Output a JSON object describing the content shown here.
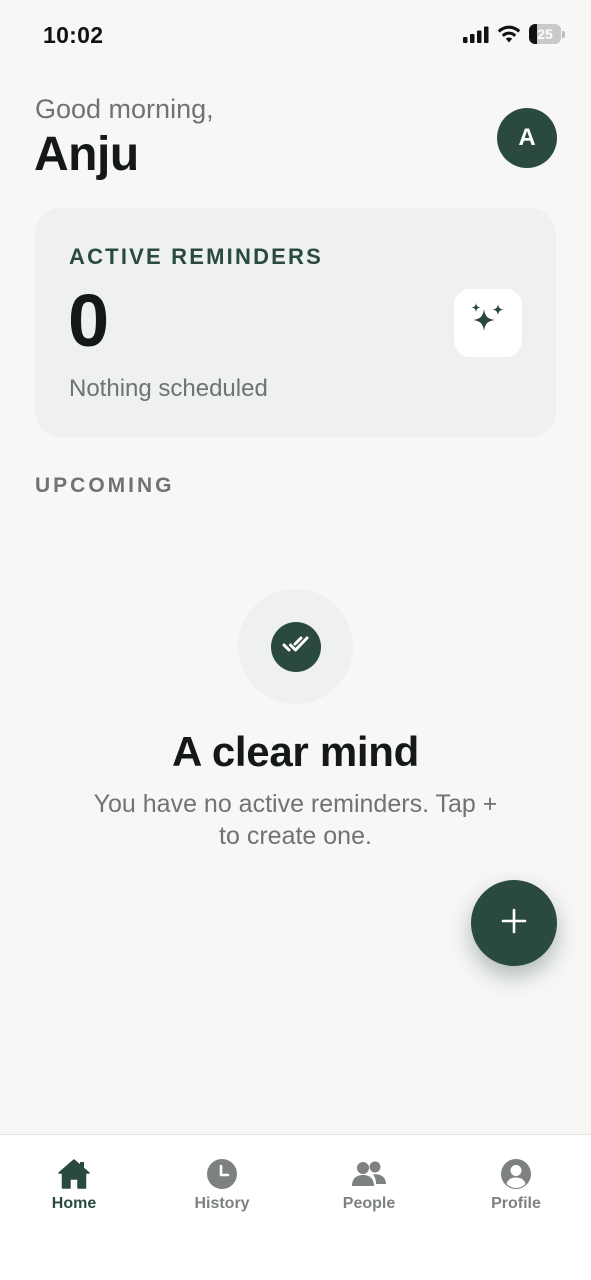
{
  "status_bar": {
    "time": "10:02",
    "battery_level": "25",
    "icons": [
      "signal-icon",
      "wifi-icon",
      "battery-icon"
    ]
  },
  "header": {
    "greeting": "Good morning,",
    "user_name": "Anju",
    "avatar_initial": "A"
  },
  "reminders_card": {
    "title": "ACTIVE REMINDERS",
    "count": "0",
    "subtitle": "Nothing scheduled",
    "icon": "sparkles-icon"
  },
  "upcoming": {
    "label": "UPCOMING",
    "empty_icon": "double-check-icon",
    "empty_title": "A clear mind",
    "empty_text": "You have no active reminders. Tap + to create one."
  },
  "fab": {
    "icon": "plus-icon",
    "label": "+"
  },
  "bottom_nav": {
    "items": [
      {
        "label": "Home",
        "icon": "home-icon",
        "active": true
      },
      {
        "label": "History",
        "icon": "clock-icon",
        "active": false
      },
      {
        "label": "People",
        "icon": "people-icon",
        "active": false
      },
      {
        "label": "Profile",
        "icon": "profile-icon",
        "active": false
      }
    ]
  },
  "colors": {
    "accent": "#2a4a3f",
    "background": "#f7f7f5",
    "card": "#eef1ee",
    "muted_text": "#6f7470"
  }
}
